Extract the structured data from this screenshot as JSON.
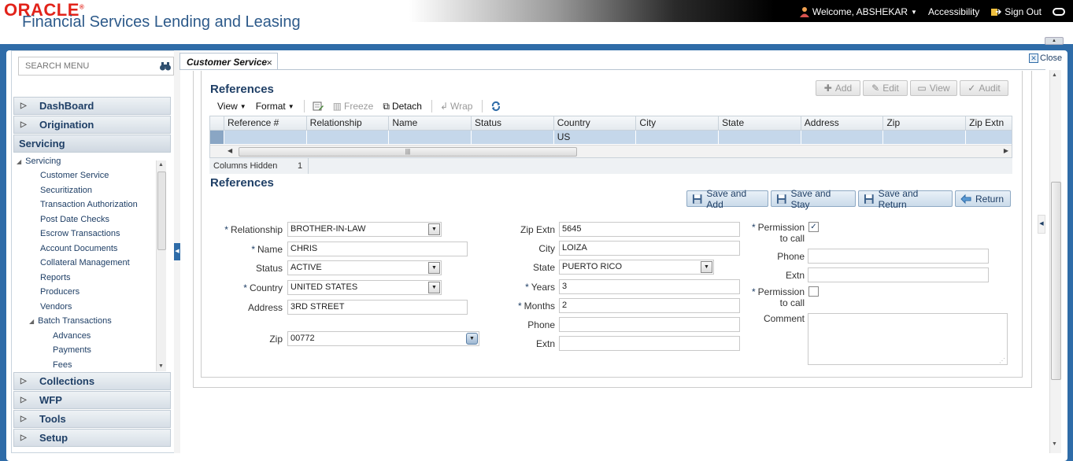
{
  "header": {
    "logo_text": "ORACLE",
    "app_title": "Financial Services Lending and Leasing",
    "welcome": "Welcome, ABSHEKAR",
    "accessibility": "Accessibility",
    "sign_out": "Sign Out"
  },
  "sidebar": {
    "search_placeholder": "SEARCH MENU",
    "sections": {
      "dashboard": "DashBoard",
      "origination": "Origination",
      "servicing": "Servicing",
      "collections": "Collections",
      "wfp": "WFP",
      "tools": "Tools",
      "setup": "Setup"
    },
    "tree": {
      "root": "Servicing",
      "items": [
        "Customer Service",
        "Securitization",
        "Transaction Authorization",
        "Post Date Checks",
        "Escrow Transactions",
        "Account Documents",
        "Collateral Management",
        "Reports",
        "Producers",
        "Vendors",
        "Batch Transactions"
      ],
      "batch_children": [
        "Advances",
        "Payments",
        "Fees"
      ]
    }
  },
  "tab": {
    "label": "Customer Service",
    "close_label": "Close"
  },
  "grid_section": {
    "title": "References",
    "actions": {
      "add": "Add",
      "edit": "Edit",
      "view": "View",
      "audit": "Audit"
    },
    "toolbar": {
      "view": "View",
      "format": "Format",
      "freeze": "Freeze",
      "detach": "Detach",
      "wrap": "Wrap"
    },
    "columns": [
      "Reference #",
      "Relationship",
      "Name",
      "Status",
      "Country",
      "City",
      "State",
      "Address",
      "Zip",
      "Zip Extn"
    ],
    "row": [
      "",
      "",
      "",
      "",
      "US",
      "",
      "",
      "",
      "",
      ""
    ],
    "columns_hidden_label": "Columns Hidden",
    "columns_hidden_value": "1"
  },
  "form_section": {
    "title": "References",
    "buttons": {
      "save_add": "Save and Add",
      "save_stay": "Save and Stay",
      "save_return": "Save and Return",
      "return": "Return"
    },
    "labels": {
      "relationship": "Relationship",
      "name": "Name",
      "status": "Status",
      "country": "Country",
      "address": "Address",
      "zip": "Zip",
      "zip_extn": "Zip Extn",
      "city": "City",
      "state": "State",
      "years": "Years",
      "months": "Months",
      "phone": "Phone",
      "extn": "Extn",
      "permission_to_call": "Permission to call",
      "phone2": "Phone",
      "extn2": "Extn",
      "permission_to_call2": "Permission to call",
      "comment": "Comment"
    },
    "values": {
      "relationship": "BROTHER-IN-LAW",
      "name": "CHRIS",
      "status": "ACTIVE",
      "country": "UNITED STATES",
      "address": "3RD STREET",
      "zip": "00772",
      "zip_extn": "5645",
      "city": "LOIZA",
      "state": "PUERTO RICO",
      "years": "3",
      "months": "2",
      "phone": "",
      "extn": "",
      "phone2": "",
      "extn2": "",
      "comment": "",
      "permission_to_call": true,
      "permission_to_call2": false
    }
  },
  "colors": {
    "frame_blue": "#2f6ca8",
    "oracle_red": "#e2231a",
    "title_blue": "#1f3f66",
    "row_selected": "#c5d7ea"
  }
}
